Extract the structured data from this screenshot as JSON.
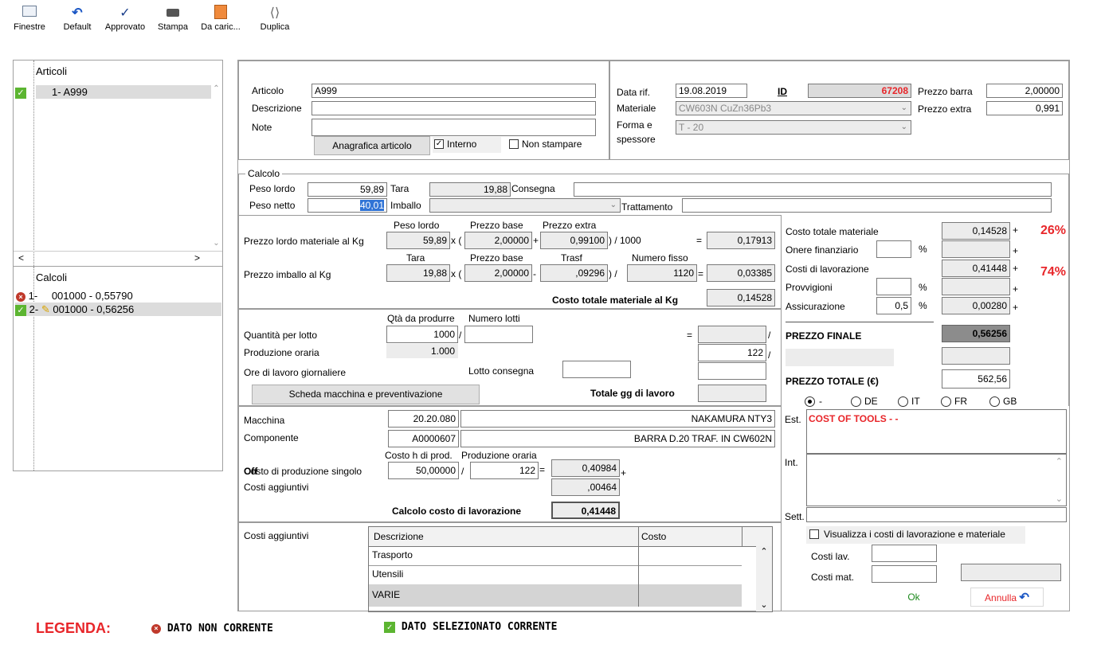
{
  "toolbar": {
    "finestre": "Finestre",
    "default": "Default",
    "approvato": "Approvato",
    "stampa": "Stampa",
    "da_caric": "Da caric...",
    "duplica": "Duplica"
  },
  "left": {
    "articoli_header": "Articoli",
    "articoli_item": "1- A999",
    "calcoli_header": "Calcoli",
    "calcolo_1_num": "1-",
    "calcolo_1": "001000 - 0,55790",
    "calcolo_2_num": "2-",
    "calcolo_2": "001000 - 0,56256"
  },
  "top": {
    "articolo_label": "Articolo",
    "articolo_value": "A999",
    "descrizione_label": "Descrizione",
    "descrizione_value": "",
    "note_label": "Note",
    "note_value": "",
    "anagrafica_button": "Anagrafica articolo",
    "interno_label": "Interno",
    "non_stampare_label": "Non stampare",
    "data_rif_label": "Data rif.",
    "data_rif_value": "19.08.2019",
    "id_label": "ID",
    "id_value": "67208",
    "materiale_label": "Materiale",
    "materiale_value": "CW603N CuZn36Pb3",
    "forma_label_1": "Forma e",
    "forma_label_2": "spessore",
    "forma_value": "T - 20",
    "prezzo_barra_label": "Prezzo barra",
    "prezzo_barra_value": "2,00000",
    "prezzo_extra_label": "Prezzo extra",
    "prezzo_extra_value": "0,991"
  },
  "calcolo": {
    "title": "Calcolo",
    "peso_lordo_label": "Peso lordo",
    "peso_lordo_value": "59,89",
    "tara_label": "Tara",
    "tara_value": "19,88",
    "consegna_label": "Consegna",
    "consegna_value": "",
    "peso_netto_label": "Peso netto",
    "peso_netto_value": "40,01",
    "imballo_label": "Imballo",
    "imballo_value": "",
    "trattamento_label": "Trattamento",
    "trattamento_value": ""
  },
  "materiale": {
    "h_peso_lordo": "Peso lordo",
    "h_prezzo_base": "Prezzo base",
    "h_prezzo_extra": "Prezzo extra",
    "row1_label": "Prezzo lordo materiale al Kg",
    "row1_v1": "59,89",
    "op_x1": "x (",
    "row1_v2": "2,00000",
    "op_plus": "+",
    "row1_v3": "0,99100",
    "op_div1000": ") / 1000",
    "op_eq1": "=",
    "row1_result": "0,17913",
    "h_tara": "Tara",
    "h_prezzo_base2": "Prezzo base",
    "h_trasf": "Trasf",
    "h_numero_fisso": "Numero fisso",
    "row2_label": "Prezzo imballo al Kg",
    "row2_v1": "19,88",
    "op_x2": "x (",
    "row2_v2": "2,00000",
    "op_minus": "-",
    "row2_v3": ",09296",
    "op_div": ") /",
    "row2_v4": "1120",
    "op_eq2": "=",
    "row2_result": "0,03385",
    "totale_label": "Costo totale materiale al Kg",
    "totale_value": "0,14528"
  },
  "produzione": {
    "h_qta": "Qtà da produrre",
    "h_lotti": "Numero lotti",
    "qta_label": "Quantità per lotto",
    "qta_value": "1000",
    "lotti_value": "",
    "op_slash1": "/",
    "op_eq": "=",
    "op_slash2": "/",
    "op_slash3": "/",
    "prod_oraria_label": "Produzione oraria",
    "prod_oraria_value": "1.000",
    "prod_oraria_right": "122",
    "ore_label": "Ore di lavoro giornaliere",
    "lotto_consegna_label": "Lotto consegna",
    "scheda_button": "Scheda macchina e preventivazione",
    "totale_gg_label": "Totale gg di lavoro",
    "totale_gg_value": ""
  },
  "macchina": {
    "macchina_label": "Macchina",
    "macchina_code": "20.20.080",
    "macchina_name": "NAKAMURA NTY3",
    "componente_label": "Componente",
    "componente_code": "A0000607",
    "componente_name": "BARRA  D.20 TRAF. IN CW602N",
    "h_costo_h": "Costo h di prod.",
    "h_prod_oraria": "Produzione oraria",
    "costo_singolo_label": "Costo di produzione singolo",
    "costo_singolo_overlap": "Off",
    "costo_h_value": "50,00000",
    "op_slash": "/",
    "prod_value": "122",
    "op_eq": "=",
    "costo_result": "0,40984",
    "op_plus": "+",
    "aggiuntivi_label": "Costi aggiuntivi",
    "aggiuntivi_value": ",00464",
    "calcolo_label": "Calcolo costo di lavorazione",
    "calcolo_value": "0,41448"
  },
  "costi_aggiuntivi": {
    "label": "Costi aggiuntivi",
    "col_descrizione": "Descrizione",
    "col_costo": "Costo",
    "rows": [
      {
        "descrizione": "Trasporto",
        "costo": ""
      },
      {
        "descrizione": "Utensili",
        "costo": ""
      },
      {
        "descrizione": "VARIE",
        "costo": ""
      }
    ]
  },
  "riepilogo": {
    "costo_totale_materiale_label": "Costo totale materiale",
    "costo_totale_materiale_value": "0,14528",
    "pct_materiale": "26%",
    "onere_label": "Onere finanziario",
    "onere_pct": "",
    "pct_sign": "%",
    "costi_lavorazione_label": "Costi di lavorazione",
    "costi_lavorazione_value": "0,41448",
    "pct_lavorazione": "74%",
    "provvigioni_label": "Provvigioni",
    "provvigioni_pct": "",
    "assicurazione_label": "Assicurazione",
    "assicurazione_pct": "0,5",
    "assicurazione_value": "0,00280",
    "plus": "+",
    "prezzo_finale_label": "PREZZO FINALE",
    "prezzo_finale_value": "0,56256",
    "prezzo_totale_label": "PREZZO TOTALE (€)",
    "prezzo_totale_value": "562,56"
  },
  "lingue": {
    "dot": "-",
    "de": "DE",
    "it": "IT",
    "fr": "FR",
    "gb": "GB"
  },
  "note_block": {
    "est_label": "Est.",
    "est_value": "COST OF TOOLS  -  -",
    "int_label": "Int.",
    "sett_label": "Sett."
  },
  "visualizza": {
    "label": "Visualizza i costi di lavorazione e materiale",
    "costi_lav_label": "Costi lav.",
    "costi_mat_label": "Costi mat.",
    "ok": "Ok",
    "annulla": "Annulla"
  },
  "legenda": {
    "title": "LEGENDA:",
    "non_corrente": "DATO NON CORRENTE",
    "selezionato": "DATO SELEZIONATO CORRENTE"
  },
  "colors": {
    "accent_red": "#e8262a",
    "check_green": "#5cb531",
    "toolbar_blue": "#1a56c4"
  }
}
